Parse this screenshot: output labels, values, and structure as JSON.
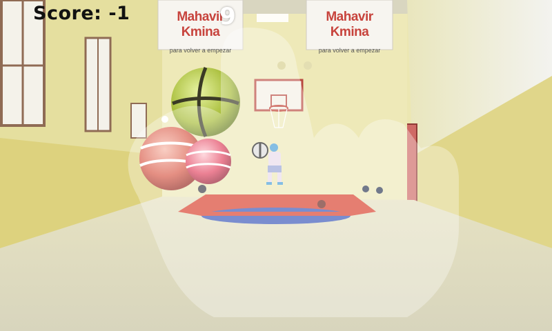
{
  "hud": {
    "score_text": "Score: -1",
    "countdown": "9"
  },
  "banners": [
    {
      "brand": "Mahavir Kmina",
      "tagline": "para volver a empezar"
    },
    {
      "brand": "Mahavir Kmina",
      "tagline": "para volver a empezar"
    }
  ],
  "colors": {
    "wall": "#e8e2a6",
    "floor": "#ddd9b8",
    "court_red": "#d9412f",
    "court_blue": "#3b58b9",
    "banner_text": "#c7433c",
    "overlay_ghost": "#ffffff"
  },
  "icons": {
    "hand_cursor_overlay": "hand-cursor-overlay-icon"
  }
}
